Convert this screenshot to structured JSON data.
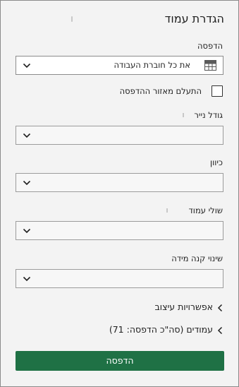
{
  "panel": {
    "title": "הגדרת עמוד"
  },
  "printer_section": {
    "label": "הדפסה",
    "selected_value": "את כל חוברת העבודה",
    "icon": "spreadsheet-grid-icon"
  },
  "ignore_print_area": {
    "label": "התעלם מאזור ההדפסה",
    "checked": false
  },
  "paper_size": {
    "label": "גודל נייר",
    "selected_value": ""
  },
  "orientation": {
    "label": "כיוון",
    "selected_value": ""
  },
  "margins": {
    "label": "שולי עמוד",
    "selected_value": ""
  },
  "scaling": {
    "label": "שינוי קנה מידה",
    "selected_value": ""
  },
  "formatting_options": {
    "label": "אפשרויות עיצוב"
  },
  "pages": {
    "label": "עמודים (סה\"כ הדפסה: 71)"
  },
  "print_button": {
    "label": "הדפסה"
  },
  "colors": {
    "accent": "#1f7145",
    "panel_bg": "#f3f3f3"
  }
}
